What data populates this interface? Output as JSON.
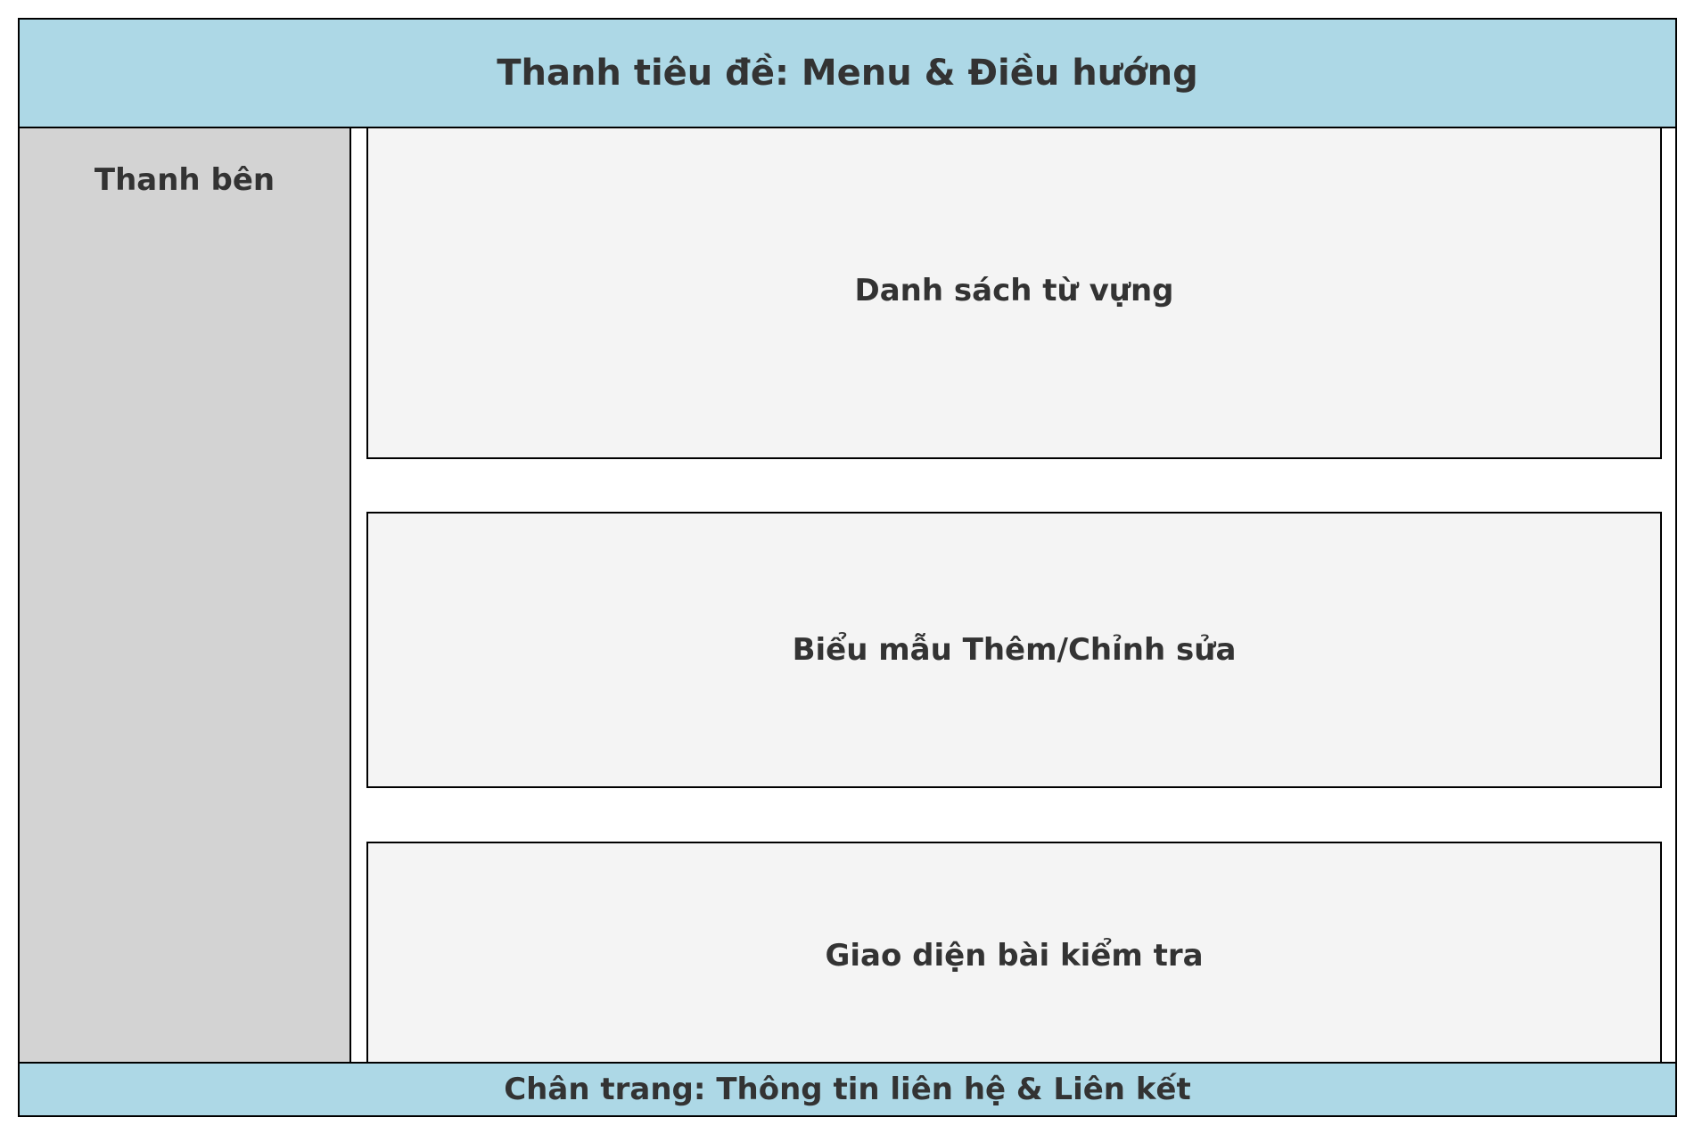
{
  "header": {
    "title": "Thanh tiêu đề: Menu & Điều hướng"
  },
  "sidebar": {
    "title": "Thanh bên"
  },
  "main": {
    "panels": [
      {
        "label": "Danh sách từ vựng"
      },
      {
        "label": "Biểu mẫu Thêm/Chỉnh sửa"
      },
      {
        "label": "Giao diện bài kiểm tra"
      }
    ]
  },
  "footer": {
    "text": "Chân trang: Thông tin liên hệ & Liên kết"
  },
  "colors": {
    "header_bg": "#add8e6",
    "footer_bg": "#add8e6",
    "sidebar_bg": "#d3d3d3",
    "panel_bg": "#f4f4f4",
    "border": "#000000",
    "text": "#333333"
  }
}
